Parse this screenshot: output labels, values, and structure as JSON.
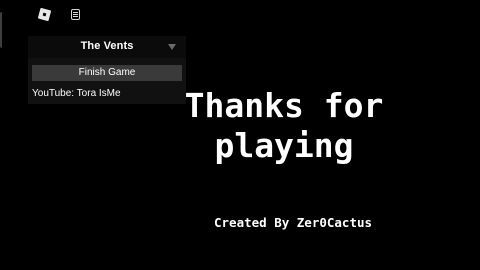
{
  "topbar": {
    "roblox_icon": "roblox-logo-icon",
    "chat_icon": "chat-icon"
  },
  "panel": {
    "title": "The Vents",
    "collapse_icon": "chevron-down-icon",
    "finish_button_label": "Finish Game",
    "youtube_label": "YouTube: Tora IsMe"
  },
  "main": {
    "thanks_text": "Thanks for playing",
    "credit_text": "Created By Zer0Cactus"
  },
  "colors": {
    "background": "#000000",
    "text": "#ffffff",
    "panel_bg": "#111111",
    "button_bg": "#3a3a3a"
  }
}
